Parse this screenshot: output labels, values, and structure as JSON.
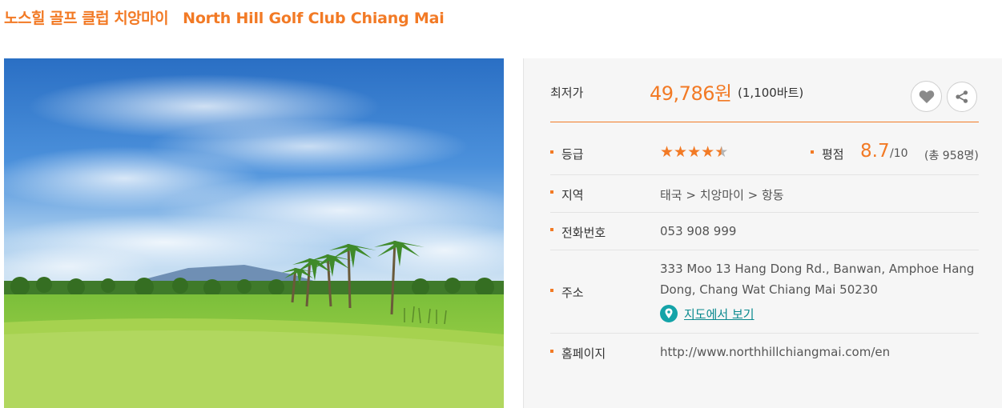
{
  "title": {
    "korean": "노스힐 골프 클럽 치앙마이",
    "english": "North Hill Golf Club Chiang Mai"
  },
  "colors": {
    "accent": "#f27a25",
    "link": "#0b8a8f",
    "panel_bg": "#f6f6f6"
  },
  "price": {
    "label": "최저가",
    "value": "49,786원",
    "sub": "(1,100바트)"
  },
  "actions": {
    "like_icon": "heart-icon",
    "share_icon": "share-icon"
  },
  "grade": {
    "label": "등급",
    "stars": 4.5,
    "max_stars": 5
  },
  "rating": {
    "label": "평점",
    "score": "8.7",
    "scale": "/10",
    "count": "(총 958명)"
  },
  "region": {
    "label": "지역",
    "value": "태국 > 치앙마이 > 항동"
  },
  "phone": {
    "label": "전화번호",
    "value": "053 908 999"
  },
  "address": {
    "label": "주소",
    "value": "333 Moo 13 Hang Dong Rd., Banwan, Amphoe Hang Dong, Chang Wat Chiang Mai 50230",
    "map_link": "지도에서 보기"
  },
  "homepage": {
    "label": "홈페이지",
    "value": "http://www.northhillchiangmai.com/en"
  }
}
